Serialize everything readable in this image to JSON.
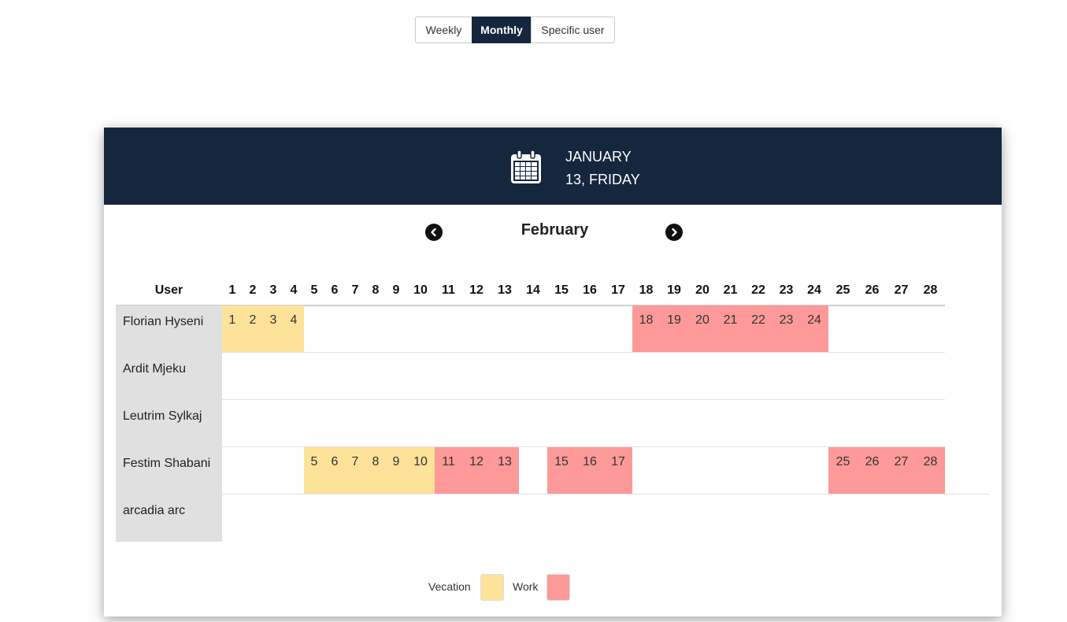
{
  "view_toggle": {
    "weekly": "Weekly",
    "monthly": "Monthly",
    "specific_user": "Specific user",
    "active": "monthly"
  },
  "header": {
    "icon": "calendar-icon",
    "month": "JANUARY",
    "day": "13, FRIDAY"
  },
  "calendar": {
    "month": "February",
    "prev_icon": "chevron-left-icon",
    "next_icon": "chevron-right-icon",
    "user_column_label": "User",
    "days": [
      "1",
      "2",
      "3",
      "4",
      "5",
      "6",
      "7",
      "8",
      "9",
      "10",
      "11",
      "12",
      "13",
      "14",
      "15",
      "16",
      "17",
      "18",
      "19",
      "20",
      "21",
      "22",
      "23",
      "24",
      "25",
      "26",
      "27",
      "28"
    ],
    "users": [
      {
        "name": "Florian Hyseni",
        "entries": [
          {
            "day": "1",
            "type": "vacation"
          },
          {
            "day": "2",
            "type": "vacation"
          },
          {
            "day": "3",
            "type": "vacation"
          },
          {
            "day": "4",
            "type": "vacation"
          },
          {
            "day": "18",
            "type": "work"
          },
          {
            "day": "19",
            "type": "work"
          },
          {
            "day": "20",
            "type": "work"
          },
          {
            "day": "21",
            "type": "work"
          },
          {
            "day": "22",
            "type": "work"
          },
          {
            "day": "23",
            "type": "work"
          },
          {
            "day": "24",
            "type": "work"
          }
        ]
      },
      {
        "name": "Ardit Mjeku",
        "entries": []
      },
      {
        "name": "Leutrim Sylkaj",
        "entries": []
      },
      {
        "name": "Festim Shabani",
        "entries": [
          {
            "day": "5",
            "type": "vacation"
          },
          {
            "day": "6",
            "type": "vacation"
          },
          {
            "day": "7",
            "type": "vacation"
          },
          {
            "day": "8",
            "type": "vacation"
          },
          {
            "day": "9",
            "type": "vacation"
          },
          {
            "day": "10",
            "type": "vacation"
          },
          {
            "day": "11",
            "type": "work"
          },
          {
            "day": "12",
            "type": "work"
          },
          {
            "day": "13",
            "type": "work"
          },
          {
            "day": "15",
            "type": "work"
          },
          {
            "day": "16",
            "type": "work"
          },
          {
            "day": "17",
            "type": "work"
          },
          {
            "day": "25",
            "type": "work"
          },
          {
            "day": "26",
            "type": "work"
          },
          {
            "day": "27",
            "type": "work"
          },
          {
            "day": "28",
            "type": "work"
          }
        ]
      },
      {
        "name": "arcadia arc",
        "entries": []
      }
    ]
  },
  "legend": {
    "vacation_label": "Vecation",
    "work_label": "Work"
  },
  "colors": {
    "header_bg": "#14273d",
    "vacation": "#fde29a",
    "work": "#fe9999",
    "user_cell_bg": "#e0e0e0"
  }
}
